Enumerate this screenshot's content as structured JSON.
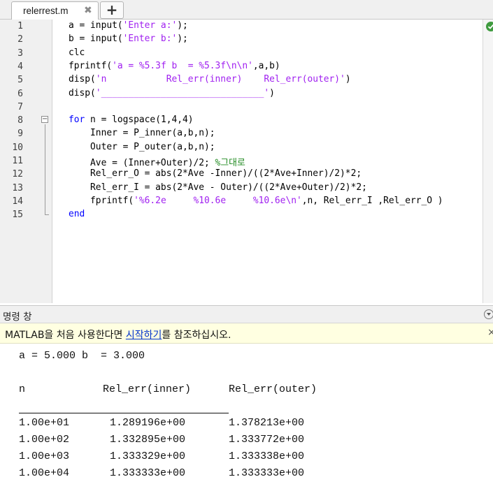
{
  "tab": {
    "filename": "relerrest.m",
    "close_symbol": "✖",
    "add_symbol": "+"
  },
  "editor": {
    "status_icon": "check-circle-icon",
    "lines": [
      {
        "n": "1",
        "segs": [
          [
            "",
            "a = input("
          ],
          [
            "str",
            "'Enter a:'"
          ],
          [
            "",
            ");"
          ]
        ]
      },
      {
        "n": "2",
        "segs": [
          [
            "",
            "b = input("
          ],
          [
            "str",
            "'Enter b:'"
          ],
          [
            "",
            ");"
          ]
        ]
      },
      {
        "n": "3",
        "segs": [
          [
            "",
            "clc"
          ]
        ]
      },
      {
        "n": "4",
        "segs": [
          [
            "",
            "fprintf("
          ],
          [
            "str",
            "'a = %5.3f b  = %5.3f\\n\\n'"
          ],
          [
            "",
            ",a,b)"
          ]
        ]
      },
      {
        "n": "5",
        "segs": [
          [
            "",
            "disp("
          ],
          [
            "str",
            "'n           Rel_err(inner)    Rel_err(outer)'"
          ],
          [
            "",
            ")"
          ]
        ]
      },
      {
        "n": "6",
        "segs": [
          [
            "",
            "disp("
          ],
          [
            "str",
            "'______________________________'"
          ],
          [
            "",
            ")"
          ]
        ]
      },
      {
        "n": "7",
        "segs": []
      },
      {
        "n": "8",
        "segs": [
          [
            "kw",
            "for"
          ],
          [
            "",
            " n = logspace(1,4,4)"
          ]
        ]
      },
      {
        "n": "9",
        "segs": [
          [
            "",
            "    Inner = P_inner(a,b,n);"
          ]
        ]
      },
      {
        "n": "10",
        "segs": [
          [
            "",
            "    Outer = P_outer(a,b,n);"
          ]
        ]
      },
      {
        "n": "11",
        "segs": [
          [
            "",
            "    Ave = (Inner+Outer)/2; "
          ],
          [
            "cmt",
            "%그대로"
          ]
        ]
      },
      {
        "n": "12",
        "segs": [
          [
            "",
            "    Rel_err_O = abs(2*Ave -Inner)/((2*Ave+Inner)/2)*2;"
          ]
        ]
      },
      {
        "n": "13",
        "segs": [
          [
            "",
            "    Rel_err_I = abs(2*Ave - Outer)/((2*Ave+Outer)/2)*2;"
          ]
        ]
      },
      {
        "n": "14",
        "segs": [
          [
            "",
            "    fprintf("
          ],
          [
            "str",
            "'%6.2e     %10.6e     %10.6e\\n'"
          ],
          [
            "",
            ",n, Rel_err_I ,Rel_err_O )"
          ]
        ]
      },
      {
        "n": "15",
        "segs": [
          [
            "kw",
            "end"
          ]
        ]
      }
    ]
  },
  "command_window": {
    "title": "명령 창",
    "banner": {
      "before": "MATLAB을 처음 사용한다면 ",
      "link": "시작하기",
      "after": "를 참조하십시오.",
      "close_symbol": "×"
    },
    "output": {
      "header_line": "a = 5.000 b  = 3.000",
      "columns": [
        "n",
        "Rel_err(inner)",
        "Rel_err(outer)"
      ],
      "rows": [
        [
          "1.00e+01",
          "1.289196e+00",
          "1.378213e+00"
        ],
        [
          "1.00e+02",
          "1.332895e+00",
          "1.333772e+00"
        ],
        [
          "1.00e+03",
          "1.333329e+00",
          "1.333338e+00"
        ],
        [
          "1.00e+04",
          "1.333333e+00",
          "1.333333e+00"
        ]
      ]
    }
  }
}
